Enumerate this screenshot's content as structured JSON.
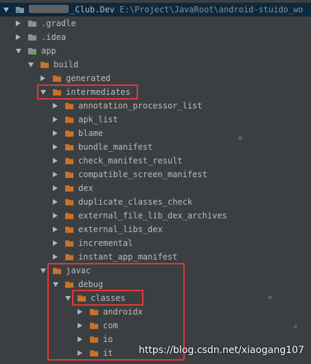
{
  "root": {
    "name_visible": "_Club.Dev",
    "path": "E:\\Project\\JavaRoot\\android-stuido_wo"
  },
  "tree": [
    {
      "label": ".gradle",
      "arrow": "right",
      "kind": "gray"
    },
    {
      "label": ".idea",
      "arrow": "right",
      "kind": "gray"
    },
    {
      "label": "app",
      "arrow": "down",
      "kind": "module"
    },
    {
      "label": "build",
      "arrow": "down",
      "kind": "orange"
    },
    {
      "label": "generated",
      "arrow": "right",
      "kind": "orange"
    },
    {
      "label": "intermediates",
      "arrow": "down",
      "kind": "orange"
    },
    {
      "label": "annotation_processor_list",
      "arrow": "right",
      "kind": "orange"
    },
    {
      "label": "apk_list",
      "arrow": "right",
      "kind": "orange"
    },
    {
      "label": "blame",
      "arrow": "right",
      "kind": "orange"
    },
    {
      "label": "bundle_manifest",
      "arrow": "right",
      "kind": "orange"
    },
    {
      "label": "check_manifest_result",
      "arrow": "right",
      "kind": "orange"
    },
    {
      "label": "compatible_screen_manifest",
      "arrow": "right",
      "kind": "orange"
    },
    {
      "label": "dex",
      "arrow": "right",
      "kind": "orange"
    },
    {
      "label": "duplicate_classes_check",
      "arrow": "right",
      "kind": "orange"
    },
    {
      "label": "external_file_lib_dex_archives",
      "arrow": "right",
      "kind": "orange"
    },
    {
      "label": "external_libs_dex",
      "arrow": "right",
      "kind": "orange"
    },
    {
      "label": "incremental",
      "arrow": "right",
      "kind": "orange"
    },
    {
      "label": "instant_app_manifest",
      "arrow": "right",
      "kind": "orange"
    },
    {
      "label": "javac",
      "arrow": "down",
      "kind": "orange"
    },
    {
      "label": "debug",
      "arrow": "down",
      "kind": "orange"
    },
    {
      "label": "classes",
      "arrow": "down",
      "kind": "orange"
    },
    {
      "label": "androidx",
      "arrow": "right",
      "kind": "orange"
    },
    {
      "label": "com",
      "arrow": "right",
      "kind": "orange"
    },
    {
      "label": "io",
      "arrow": "right",
      "kind": "orange"
    },
    {
      "label": "it",
      "arrow": "right",
      "kind": "orange"
    }
  ],
  "watermark": "https://blog.csdn.net/xiaogang107",
  "colors": {
    "background": "#3c3f41",
    "folder_orange": "#c7722a",
    "folder_gray": "#8a9196",
    "highlight": "#e53935"
  }
}
